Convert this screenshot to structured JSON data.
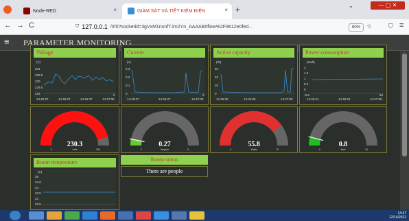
{
  "browser": {
    "tab1_title": "Node-RED",
    "tab2_title": "GIÁM SÁT VÀ TIẾT KIỆM ĐIỆN",
    "new_tab": "+",
    "close": "×",
    "url_host": "127.0.0.1",
    "url_rest": "/#/0?socketid=3gVxM1nsnfTJm2Yn_AAAAB#flow%2F9612e0fed...",
    "zoom": "80%",
    "back": "←",
    "forward": "→",
    "reload": "C",
    "menu_icon": "≡"
  },
  "header": {
    "menu_icon": "≡",
    "title": "PARAMETER MONITORING"
  },
  "panels": {
    "voltage": {
      "title": "Voltage",
      "unit": "(V)",
      "yticks": [
        "231",
        "230.5",
        "230",
        "229.5",
        "229"
      ],
      "xticks": [
        "14:45:37",
        "14:46:07",
        "14:46:37",
        "14:47:06"
      ],
      "end_label": "0"
    },
    "current": {
      "title": "Current",
      "unit": "(A)",
      "yticks": [
        "0.3",
        "0.2",
        "0.1",
        "0"
      ],
      "xticks": [
        "14:45:37",
        "14:46:27",
        "14:47:05"
      ],
      "end_label": "0"
    },
    "active_capacity": {
      "title": "Active capacity",
      "unit": "(W)",
      "yticks": [
        "60",
        "40",
        "20",
        "0"
      ],
      "xticks": [
        "14:45:36",
        "14:46:06",
        "14:47:05"
      ]
    },
    "power_consumption": {
      "title": "Power consumption",
      "unit": "(Kwh)",
      "yticks": [
        "2",
        "1.5",
        "1",
        "0.5",
        "0",
        "-0.5"
      ],
      "xticks": [
        "14:46:41",
        "14:46:01",
        "14:47:06"
      ],
      "end_label": "63"
    },
    "room_temperature": {
      "title": "Room temperature",
      "unit": "(C)",
      "yticks": [
        "25",
        "24.5",
        "24",
        "23.5",
        "23",
        "22.5"
      ],
      "xticks": [
        "14:45:42",
        "14:46:52",
        "14:47:06"
      ]
    },
    "room_status": {
      "title": "Room status",
      "value": "There are people"
    }
  },
  "gauges": {
    "voltage": {
      "value": "230.3",
      "min": "0",
      "max": "250",
      "unit": "volts",
      "level": 0.92,
      "color": "#ff1111"
    },
    "current": {
      "value": "0.27",
      "min": "0",
      "max": "5",
      "unit": "Ampere",
      "level": 0.06,
      "color": "#66cc33"
    },
    "active_capacity": {
      "value": "55.8",
      "min": "0",
      "max": "70",
      "unit": "Watts",
      "level": 0.8,
      "color": "#e03030"
    },
    "power_consumption": {
      "value": "0.8",
      "min": "0",
      "max": "10",
      "unit": "Kwh",
      "level": 0.08,
      "color": "#22bb22"
    }
  },
  "colors": {
    "group_header_bg": "#8fd14f",
    "group_title": "#c0392b",
    "line": "#3a8fd6",
    "gauge_track": "#666666"
  },
  "taskbar": {
    "time": "14:47",
    "date": "12/14/2022"
  }
}
